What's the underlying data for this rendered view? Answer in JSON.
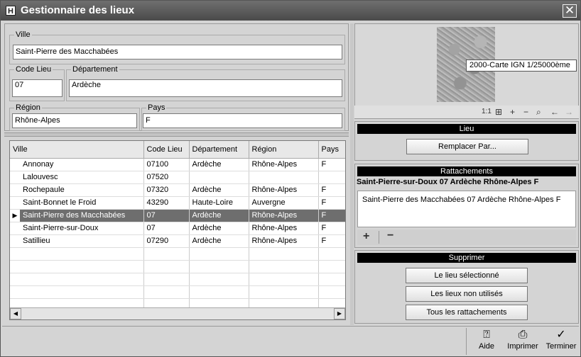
{
  "window": {
    "title": "Gestionnaire des lieux",
    "app_icon": "H",
    "close_glyph": "✕"
  },
  "form": {
    "ville_label": "Ville",
    "ville_value": "Saint-Pierre des Macchabées",
    "code_lieu_label": "Code Lieu",
    "code_lieu_value": "07",
    "departement_label": "Département",
    "departement_value": "Ardèche",
    "region_label": "Région",
    "region_value": "Rhône-Alpes",
    "pays_label": "Pays",
    "pays_value": "F"
  },
  "table": {
    "columns": [
      "Ville",
      "Code Lieu",
      "Département",
      "Région",
      "Pays"
    ],
    "rows": [
      [
        "Annonay",
        "07100",
        "Ardèche",
        "Rhône-Alpes",
        "F"
      ],
      [
        "Lalouvesc",
        "07520",
        "",
        "",
        ""
      ],
      [
        "Rochepaule",
        "07320",
        "Ardèche",
        "Rhône-Alpes",
        "F"
      ],
      [
        "Saint-Bonnet le Froid",
        "43290",
        "Haute-Loire",
        "Auvergne",
        "F"
      ],
      [
        "Saint-Pierre des Macchabées",
        "07",
        "Ardèche",
        "Rhône-Alpes",
        "F"
      ],
      [
        "Saint-Pierre-sur-Doux",
        "07",
        "Ardèche",
        "Rhône-Alpes",
        "F"
      ],
      [
        "Satillieu",
        "07290",
        "Ardèche",
        "Rhône-Alpes",
        "F"
      ]
    ],
    "selected_index": 4,
    "empty_rows": 5,
    "row_indicator": "▶",
    "scroll_left": "◀",
    "scroll_right": "▶"
  },
  "map": {
    "tooltip": "2000-Carte IGN 1/25000ème",
    "tools": [
      "1:1",
      "grid-icon",
      "zoom-in-icon",
      "zoom-out-icon",
      "search-icon",
      "back-icon",
      "forward-icon"
    ]
  },
  "lieu": {
    "header": "Lieu",
    "replace_button": "Remplacer Par..."
  },
  "rattachements": {
    "header": "Rattachements",
    "title": "Saint-Pierre-sur-Doux 07 Ardèche Rhône-Alpes F",
    "items": [
      "Saint-Pierre des Macchabées 07 Ardèche Rhône-Alpes F"
    ],
    "add_glyph": "+",
    "remove_glyph": "−"
  },
  "supprimer": {
    "header": "Supprimer",
    "buttons": [
      "Le lieu sélectionné",
      "Les lieux non utilisés",
      "Tous les rattachements"
    ]
  },
  "footer": {
    "aide": "Aide",
    "imprimer": "Imprimer",
    "terminer": "Terminer"
  },
  "colors": {
    "selection": "#6e6e6e",
    "header_bar": "#000000",
    "title_bar": "#4a4a4a"
  }
}
